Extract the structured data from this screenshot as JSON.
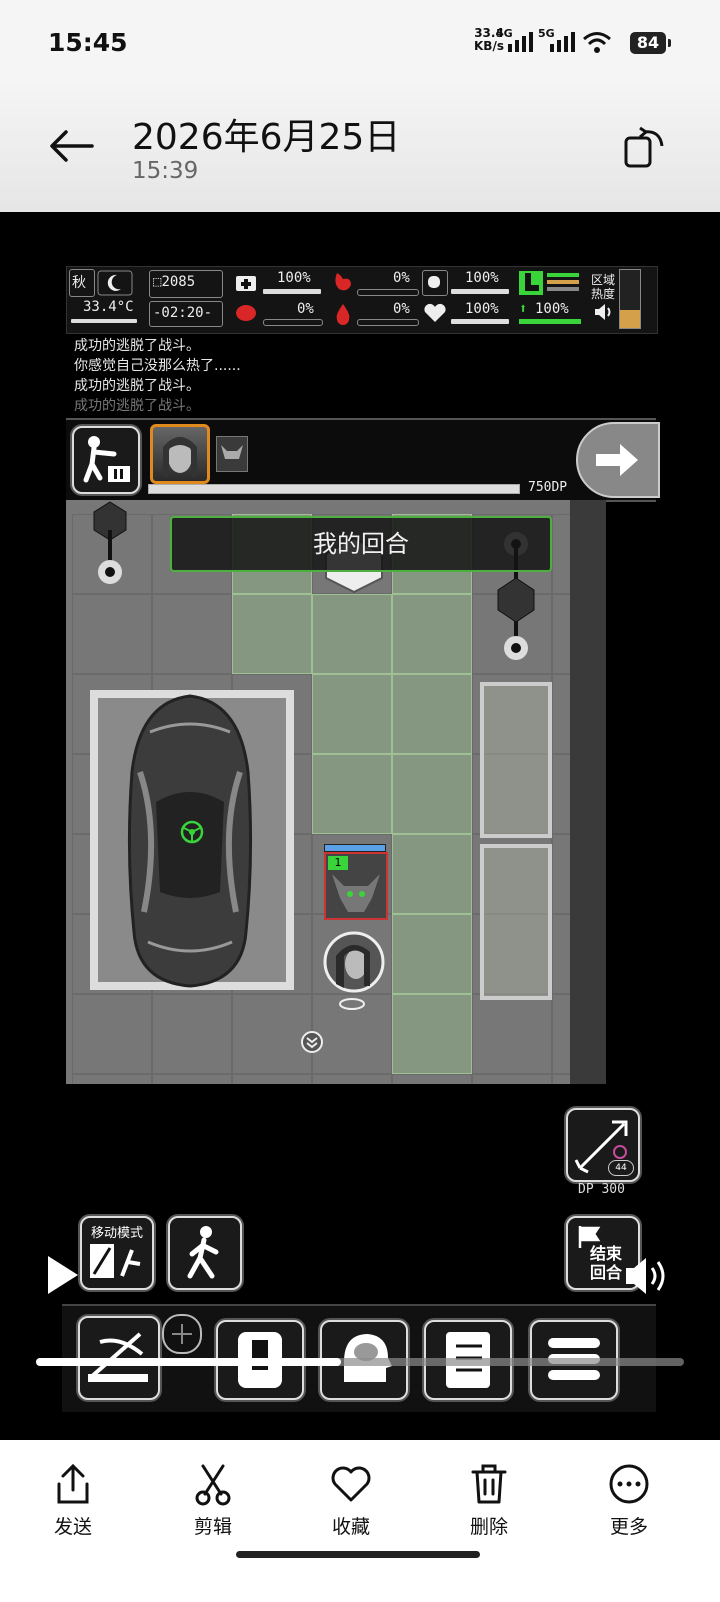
{
  "status_bar": {
    "time": "15:45",
    "net_speed_value": "33.4",
    "net_speed_unit": "KB/s",
    "sig1_label": "5G",
    "sig2_label": "5G",
    "battery": "84"
  },
  "header": {
    "title": "2026年6月25日",
    "subtitle": "15:39"
  },
  "hud": {
    "season": "秋",
    "day": "2085",
    "temperature": "33.4°C",
    "clock": "-02:20-",
    "health_pct": "100%",
    "stomach_pct": "0%",
    "bladder_pct": "100%",
    "brain_pct": "0%",
    "blood_pct": "0%",
    "heart_pct": "100%",
    "stamina_pct": "100%",
    "zone_heat_line1": "区域",
    "zone_heat_line2": "热度"
  },
  "log": {
    "lines": [
      "成功的逃脱了战斗。",
      "你感觉自己没那么热了......",
      "成功的逃脱了战斗。",
      "成功的逃脱了战斗。"
    ]
  },
  "turn": {
    "dp_label": "750DP",
    "banner": "我的回合",
    "enemy_level": "1"
  },
  "controls": {
    "dp_counter": "44",
    "dp_cost": "DP 300",
    "move_mode_label": "移动模式",
    "end_turn_line1": "结束",
    "end_turn_line2": "回合"
  },
  "video": {
    "progress": 0.47
  },
  "toolbar": {
    "send": "发送",
    "edit": "剪辑",
    "favorite": "收藏",
    "delete": "删除",
    "more": "更多"
  },
  "colors": {
    "highlight_green": "#4caf3e",
    "stamina_green": "#39d43a",
    "blood_red": "#d92626",
    "heat_orange": "#d4a04a"
  }
}
